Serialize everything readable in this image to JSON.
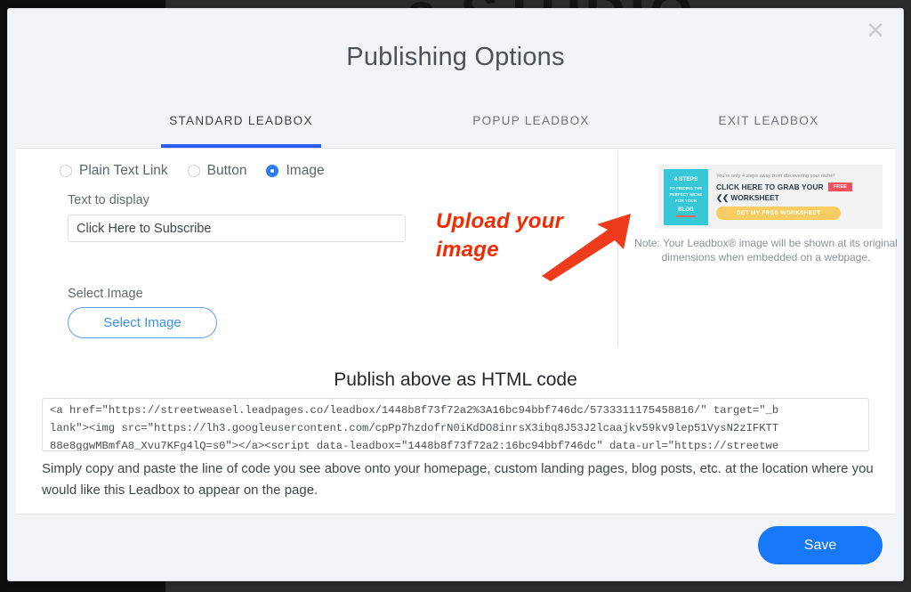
{
  "background": {
    "word": "a STUDIO"
  },
  "modal": {
    "title": "Publishing Options",
    "close_label": "✕",
    "tabs": [
      {
        "label": "STANDARD LEADBOX",
        "active": true
      },
      {
        "label": "POPUP LEADBOX",
        "active": false
      },
      {
        "label": "EXIT LEADBOX",
        "active": false
      }
    ],
    "form": {
      "link_type_options": [
        {
          "label": "Plain Text Link",
          "checked": false
        },
        {
          "label": "Button",
          "checked": false
        },
        {
          "label": "Image",
          "checked": true
        }
      ],
      "text_to_display_label": "Text to display",
      "text_to_display_value": "Click Here to Subscribe",
      "text_to_display_placeholder": "Click Here to Subscribe",
      "select_image_label": "Select Image",
      "select_image_button": "Select Image"
    },
    "annotation": {
      "line1": "Upload your",
      "line2": "image",
      "color": "#f42a00"
    },
    "preview": {
      "book": {
        "line1": "4 STEPS",
        "line2": "TO FINDING THE PERFECT NICHE FOR YOUR",
        "line3": "BLOG"
      },
      "headline_small": "You're only 4 steps away from discovering your niche!",
      "headline_line1": "CLICK HERE TO GRAB YOUR",
      "badge": "FREE",
      "headline_line2": "❮❮  WORKSHEET",
      "cta_button": "GET MY FREE WORKSHEET",
      "note": "Note: Your Leadbox® image will be shown at its original dimensions when embedded on a webpage."
    },
    "publish": {
      "heading": "Publish above as HTML code",
      "code": "<a href=\"https://streetweasel.leadpages.co/leadbox/1448b8f73f72a2%3A16bc94bbf746dc/5733311175458816/\" target=\"_b\nlank\"><img src=\"https://lh3.googleusercontent.com/cpPp7hzdofrN0iKdDO8inrsX3ibq8J53J2lcaajkv59kv9lep51VysN2zIFKTT\n88e8ggwMBmfA8_Xvu7KFg4lQ=s0\"></a><script data-leadbox=\"1448b8f73f72a2:16bc94bbf746dc\" data-url=\"https://streetwe",
      "instructions": "Simply copy and paste the line of code you see above onto your homepage, custom landing pages, blog posts, etc. at the location where you would like this Leadbox to appear on the page."
    },
    "footer": {
      "save_label": "Save",
      "save_color": "#1677f8"
    }
  }
}
